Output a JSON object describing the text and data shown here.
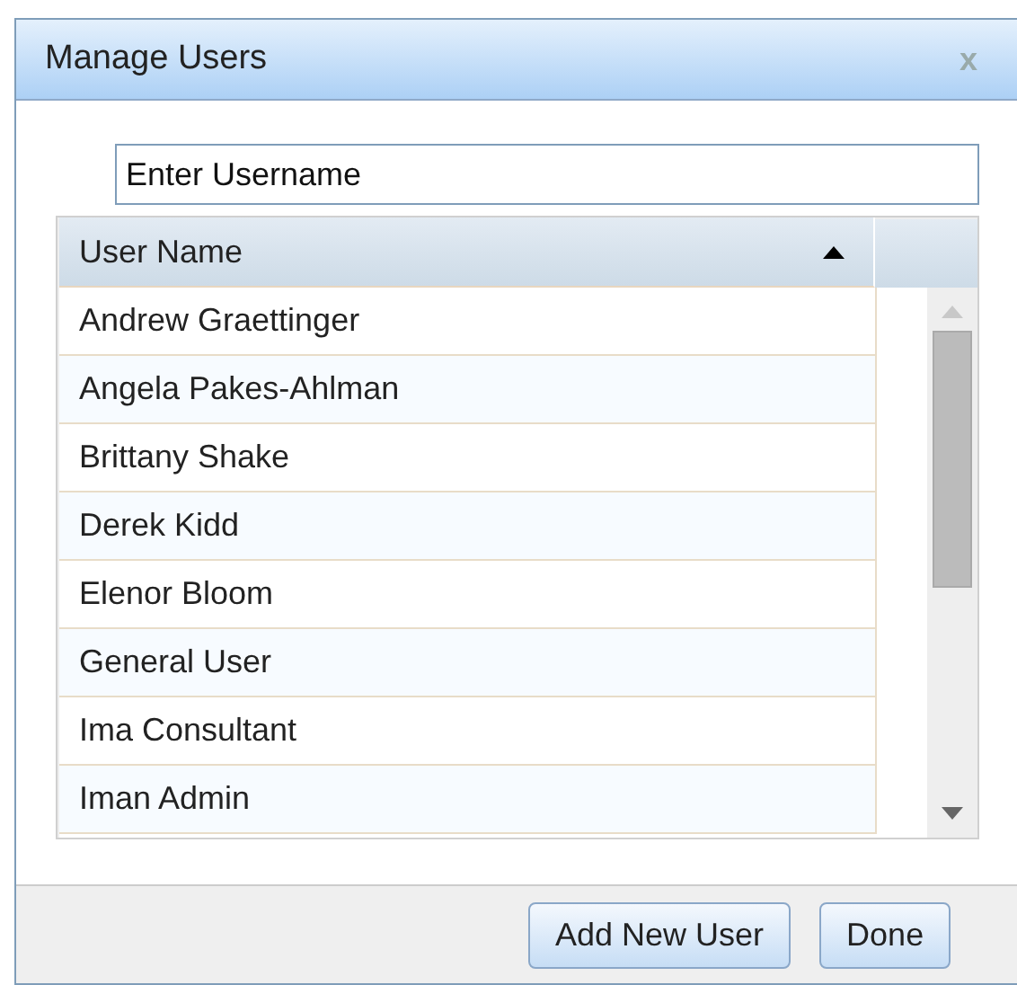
{
  "window": {
    "title": "Manage Users",
    "close": "x"
  },
  "search": {
    "value": "Enter Username"
  },
  "table": {
    "columns": [
      {
        "label": "User Name",
        "sort_ascending": true
      }
    ],
    "rows": [
      {
        "name": "Andrew Graettinger"
      },
      {
        "name": "Angela Pakes-Ahlman"
      },
      {
        "name": "Brittany Shake"
      },
      {
        "name": "Derek Kidd"
      },
      {
        "name": "Elenor Bloom"
      },
      {
        "name": "General User"
      },
      {
        "name": "Ima Consultant"
      },
      {
        "name": "Iman Admin"
      }
    ]
  },
  "buttons": [
    {
      "label": "Add New User"
    },
    {
      "label": "Done"
    }
  ]
}
